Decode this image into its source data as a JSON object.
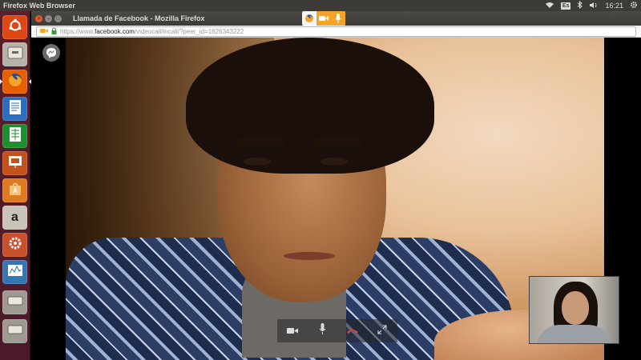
{
  "system_panel": {
    "app_title": "Firefox Web Browser",
    "keyboard_layout": "Es",
    "clock": "16:21",
    "icons": [
      "wifi-icon",
      "keyboard-layout-icon",
      "bluetooth-icon",
      "volume-icon",
      "settings-gear-icon"
    ]
  },
  "launcher": {
    "items": [
      {
        "name": "ubuntu-dash",
        "icon": "ubuntu-logo-icon",
        "color": "#dd4814"
      },
      {
        "name": "files",
        "icon": "file-cabinet-icon",
        "color": "#b7b2a8"
      },
      {
        "name": "firefox",
        "icon": "firefox-icon",
        "color": "#e66000",
        "active": true
      },
      {
        "name": "libreoffice-writer",
        "icon": "writer-icon",
        "color": "#2a6fbf"
      },
      {
        "name": "libreoffice-calc",
        "icon": "calc-icon",
        "color": "#1e8f2f"
      },
      {
        "name": "libreoffice-impress",
        "icon": "impress-icon",
        "color": "#c4501a"
      },
      {
        "name": "software-center",
        "icon": "shopping-bag-icon",
        "color": "#e07a1f"
      },
      {
        "name": "amazon",
        "icon": "amazon-icon",
        "color": "#c9c4b9",
        "glyph": "a"
      },
      {
        "name": "system-settings",
        "icon": "settings-icon",
        "color": "#c8502a"
      },
      {
        "name": "system-monitor",
        "icon": "monitor-icon",
        "color": "#3577b3"
      },
      {
        "name": "drive-1",
        "icon": "drive-icon",
        "color": "#9e9a92"
      },
      {
        "name": "drive-2",
        "icon": "drive-icon",
        "color": "#9e9a92"
      }
    ]
  },
  "window": {
    "title": "Llamada de Facebook - Mozilla Firefox",
    "share_indicator": {
      "icons": [
        "firefox-icon",
        "camera-icon",
        "microphone-icon"
      ],
      "accent": "#f4a427"
    }
  },
  "urlbar": {
    "prefix": "https://www.",
    "domain": "facebook.com",
    "path": "/videocall/incall/?peer_id=1626343222"
  },
  "call": {
    "controls": [
      "camera-icon",
      "microphone-icon",
      "end-call-icon",
      "fullscreen-icon"
    ],
    "end_call_color": "#e0403b"
  }
}
